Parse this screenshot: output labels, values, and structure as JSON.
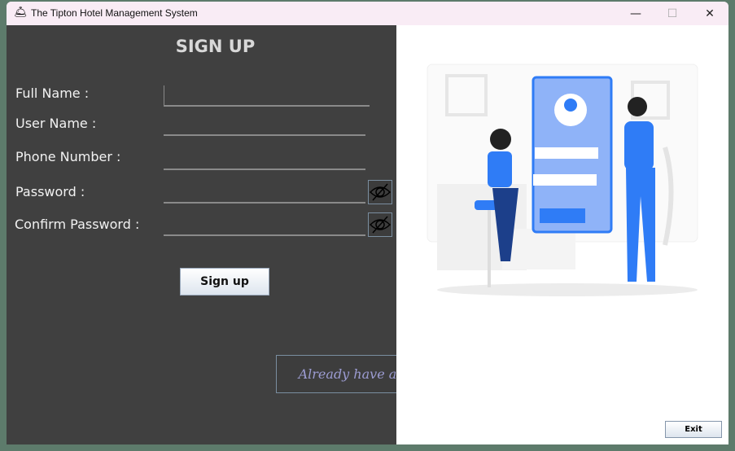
{
  "window": {
    "title": "The Tipton Hotel Management System",
    "minimize": "—",
    "maximize": "☐",
    "close": "✕"
  },
  "form": {
    "heading": "SIGN UP",
    "fields": [
      {
        "label": "Full Name :",
        "value": ""
      },
      {
        "label": "User Name :",
        "value": ""
      },
      {
        "label": "Phone Number :",
        "value": ""
      },
      {
        "label": "Password :",
        "value": ""
      },
      {
        "label": "Confirm Password :",
        "value": ""
      }
    ],
    "signup_label": "Sign up",
    "already_label": "Already have an account?"
  },
  "exit_label": "Exit",
  "colors": {
    "panel": "#404040",
    "accent": "#2f7cf6"
  }
}
